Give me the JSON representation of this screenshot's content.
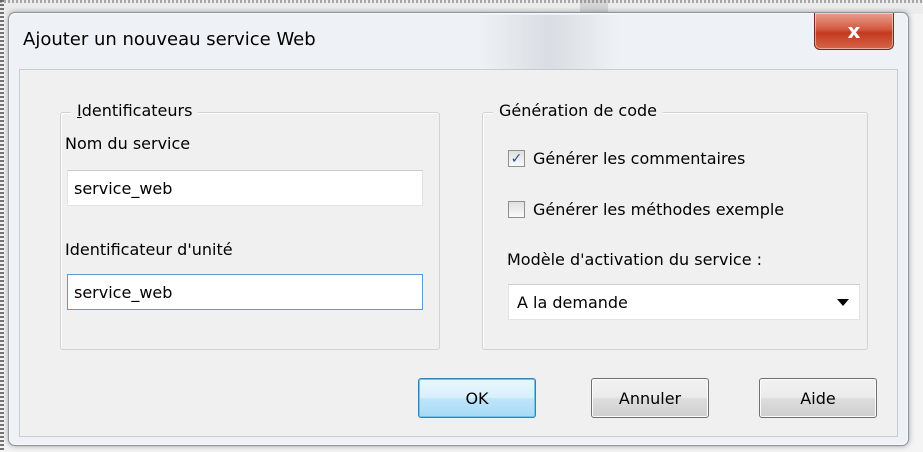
{
  "dialog": {
    "title": "Ajouter un nouveau service Web",
    "close_glyph": "x"
  },
  "identifiers": {
    "legend": "Identificateurs",
    "service_name_label": "Nom du service",
    "service_name_value": "service_web",
    "unit_label": "Identificateur d'unité",
    "unit_value": "service_web"
  },
  "codegen": {
    "legend": "Génération de code",
    "comments_label": "Générer les commentaires",
    "comments_checked": true,
    "check_glyph": "✓",
    "sample_methods_label": "Générer les méthodes exemple",
    "sample_methods_checked": false,
    "activation_label": "Modèle d'activation du service :",
    "activation_value": "A la demande"
  },
  "buttons": {
    "ok": "OK",
    "cancel": "Annuler",
    "help": "Aide"
  }
}
